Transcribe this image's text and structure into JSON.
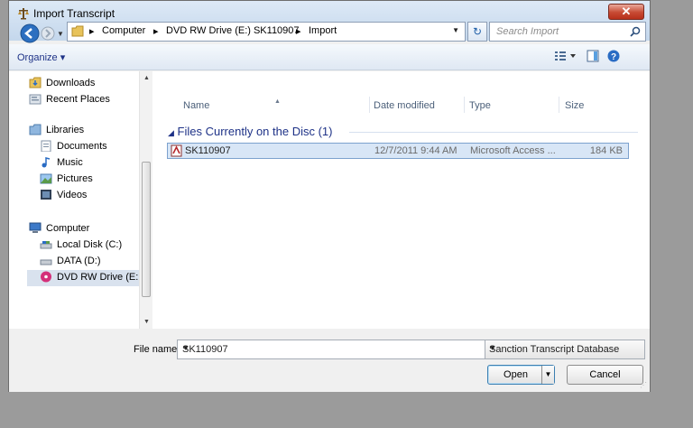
{
  "window": {
    "title": "Import Transcript",
    "close_label": "✕"
  },
  "address": {
    "crumbs": [
      "Computer",
      "DVD RW Drive (E:) SK110907",
      "Import"
    ],
    "separator": "▸"
  },
  "search": {
    "placeholder": "Search Import"
  },
  "toolbar": {
    "organize_label": "Organize ▾"
  },
  "nav": {
    "items": [
      {
        "label": "Downloads",
        "icon": "downloads-folder-icon"
      },
      {
        "label": "Recent Places",
        "icon": "recent-places-icon"
      },
      {
        "label": "Libraries",
        "icon": "libraries-icon"
      },
      {
        "label": "Documents",
        "icon": "documents-icon"
      },
      {
        "label": "Music",
        "icon": "music-icon"
      },
      {
        "label": "Pictures",
        "icon": "pictures-icon"
      },
      {
        "label": "Videos",
        "icon": "videos-icon"
      },
      {
        "label": "Computer",
        "icon": "computer-icon"
      },
      {
        "label": "Local Disk (C:)",
        "icon": "drive-icon"
      },
      {
        "label": "DATA (D:)",
        "icon": "drive-icon"
      },
      {
        "label": "DVD RW Drive (E:",
        "icon": "dvd-drive-icon",
        "selected": true
      }
    ]
  },
  "columns": {
    "name": "Name",
    "date": "Date modified",
    "type": "Type",
    "size": "Size"
  },
  "group": {
    "label": "Files Currently on the Disc (1)",
    "arrow": "◢"
  },
  "files": [
    {
      "name": "SK110907",
      "date": "12/7/2011 9:44 AM",
      "type": "Microsoft Access ...",
      "size": "184 KB"
    }
  ],
  "footer": {
    "filename_label": "File name:",
    "filename_value": "SK110907",
    "filetype": "Sanction Transcript Database",
    "open_label": "Open",
    "cancel_label": "Cancel"
  },
  "colors": {
    "accent": "#1e3287",
    "selection": "#d8e6f6",
    "close": "#c74a33"
  }
}
